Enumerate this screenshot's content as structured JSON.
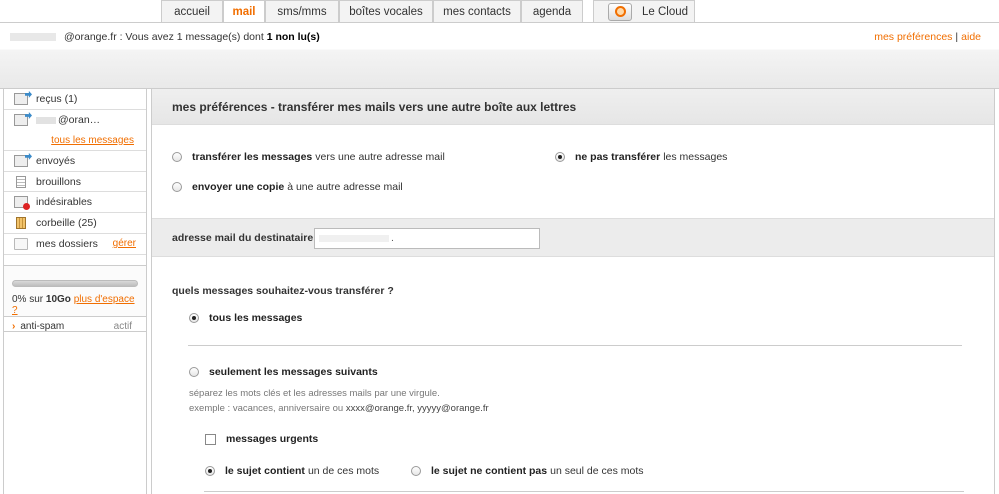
{
  "tabs": [
    {
      "label": "accueil",
      "active": false
    },
    {
      "label": "mail",
      "active": true
    },
    {
      "label": "sms/mms",
      "active": false
    },
    {
      "label": "boîtes vocales",
      "active": false
    },
    {
      "label": "mes contacts",
      "active": false
    },
    {
      "label": "agenda",
      "active": false
    }
  ],
  "cloud_tab": {
    "label": "Le Cloud",
    "icon": "cloud-icon"
  },
  "header": {
    "message_prefix": "@orange.fr : Vous avez 1 message(s) dont",
    "unread": "1 non lu(s)",
    "link_preferences": "mes préférences",
    "link_separator": "|",
    "link_help": "aide"
  },
  "sidebar": {
    "folders": {
      "received": "reçus (1)",
      "account": "@oran…",
      "all_messages": "tous les messages",
      "sent": "envoyés",
      "drafts": "brouillons",
      "spam": "indésirables",
      "trash": "corbeille (25)",
      "my_folders": "mes dossiers",
      "manage": "gérer"
    },
    "quota": {
      "used_percent": 0,
      "text_prefix": "0% sur",
      "capacity": "10Go",
      "more_space": "plus d'espace ?"
    },
    "antispam": {
      "label": "anti-spam",
      "state": "actif"
    }
  },
  "main": {
    "title": "mes préférences - transférer mes mails vers une autre boîte aux lettres",
    "mode": {
      "transfer_bold": "transférer les messages",
      "transfer_rest": "vers une autre adresse mail",
      "copy_bold": "envoyer une copie",
      "copy_rest": "à une autre adresse mail",
      "none_bold": "ne pas transférer",
      "none_rest": "les messages",
      "selected": "none"
    },
    "destination": {
      "label": "adresse mail du destinataire",
      "value": "."
    },
    "which": {
      "question": "quels messages souhaitez-vous transférer ?",
      "all": "tous les messages",
      "some": "seulement les messages suivants",
      "hint1": "séparez les mots clés et les adresses mails par une virgule.",
      "hint2_prefix": "exemple : vacances, anniversaire ou",
      "hint2_examples": "xxxx@orange.fr, yyyyy@orange.fr",
      "selected": "all"
    },
    "filters": {
      "urgent": "messages urgents",
      "urgent_checked": false,
      "subject_contains_bold": "le sujet contient",
      "subject_contains_rest": "un de ces mots",
      "subject_not_contains_bold": "le sujet ne contient pas",
      "subject_not_contains_rest": "un seul de ces mots",
      "selected": "contains"
    }
  },
  "colors": {
    "accent": "#f16e00",
    "band": "#ececec"
  }
}
